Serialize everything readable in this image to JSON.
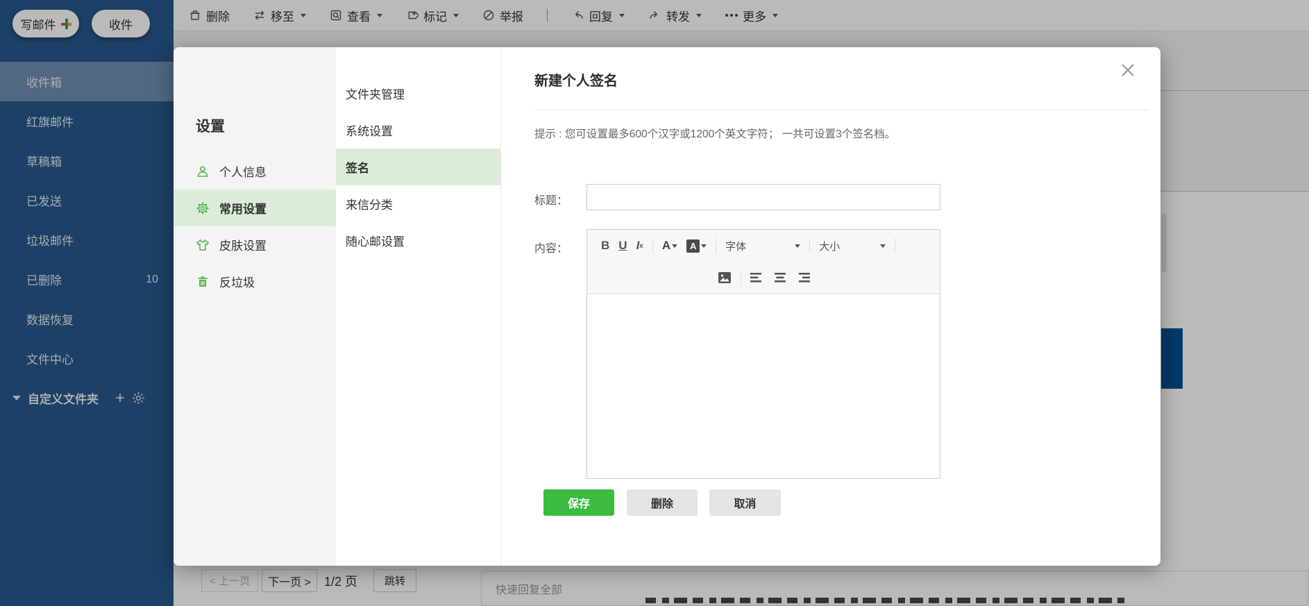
{
  "colors": {
    "sidebar_bg": "#28588c",
    "accent_green": "#3cbb40",
    "menu_icon_green": "#52b852",
    "selected_row_green": "#ddecd8",
    "hidden_blue_block": "#005092"
  },
  "sidebar": {
    "compose_button": "写邮件",
    "receive_button": "收件",
    "items": [
      {
        "label": "收件箱"
      },
      {
        "label": "红旗邮件"
      },
      {
        "label": "草稿箱"
      },
      {
        "label": "已发送"
      },
      {
        "label": "垃圾邮件"
      },
      {
        "label": "已删除",
        "count": "10"
      },
      {
        "label": "数据恢复"
      },
      {
        "label": "文件中心"
      }
    ],
    "custom_folder": {
      "label": "自定义文件夹",
      "add": "+"
    }
  },
  "toolbar": {
    "items": [
      {
        "label": "删除"
      },
      {
        "label": "移至"
      },
      {
        "label": "查看"
      },
      {
        "label": "标记"
      },
      {
        "label": "举报"
      },
      {
        "label": "回复"
      },
      {
        "label": "转发"
      },
      {
        "label": "更多"
      }
    ]
  },
  "settings": {
    "title": "设置",
    "menu": [
      {
        "label": "个人信息"
      },
      {
        "label": "常用设置"
      },
      {
        "label": "皮肤设置"
      },
      {
        "label": "反垃圾"
      }
    ],
    "submenu": [
      {
        "label": "文件夹管理"
      },
      {
        "label": "系统设置"
      },
      {
        "label": "签名"
      },
      {
        "label": "来信分类"
      },
      {
        "label": "随心邮设置"
      }
    ]
  },
  "signature_panel": {
    "title": "新建个人签名",
    "hint": "提示 : 您可设置最多600个汉字或1200个英文字符； 一共可设置3个签名档。",
    "title_label": "标题：",
    "content_label": "内容：",
    "title_value": "",
    "editor": {
      "bold_glyph": "B",
      "underline_glyph": "U",
      "clear_glyph": "I",
      "clear_sub": "x",
      "font_color_glyph": "A",
      "bg_color_glyph": "A",
      "font_family_placeholder": "字体",
      "font_size_placeholder": "大小"
    },
    "buttons": {
      "save": "保存",
      "delete": "删除",
      "cancel": "取消"
    }
  },
  "pagination": {
    "prev": "< 上一页",
    "next": "下一页 >",
    "page_info": "1/2 页",
    "jump": "跳转"
  },
  "quick_reply": {
    "placeholder": "快速回复全部"
  }
}
